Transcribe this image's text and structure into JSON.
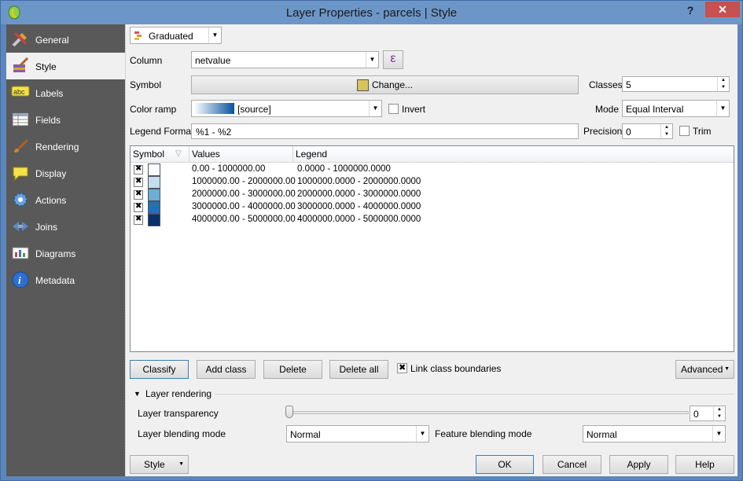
{
  "window": {
    "title": "Layer Properties - parcels | Style",
    "help_label": "?",
    "close_label": "✕"
  },
  "sidebar": {
    "items": [
      {
        "label": "General",
        "icon": "wrench-icon"
      },
      {
        "label": "Style",
        "icon": "paintbrush-icon"
      },
      {
        "label": "Labels",
        "icon": "abc-label-icon"
      },
      {
        "label": "Fields",
        "icon": "table-icon"
      },
      {
        "label": "Rendering",
        "icon": "brush-icon"
      },
      {
        "label": "Display",
        "icon": "speech-bubble-icon"
      },
      {
        "label": "Actions",
        "icon": "gear-icon"
      },
      {
        "label": "Joins",
        "icon": "join-icon"
      },
      {
        "label": "Diagrams",
        "icon": "diagram-icon"
      },
      {
        "label": "Metadata",
        "icon": "info-icon"
      }
    ],
    "active": "Style"
  },
  "renderer": {
    "type_label": "Graduated",
    "column_label": "Column",
    "column_value": "netvalue",
    "expression_label": "ε",
    "symbol_label": "Symbol",
    "change_label": "Change...",
    "classes_label": "Classes",
    "classes_value": "5",
    "color_ramp_label": "Color ramp",
    "color_ramp_value": "[source]",
    "invert_label": "Invert",
    "mode_label": "Mode",
    "mode_value": "Equal Interval",
    "legend_format_label": "Legend Format",
    "legend_format_value": "%1 - %2",
    "precision_label": "Precision",
    "precision_value": "0",
    "trim_label": "Trim"
  },
  "table": {
    "headers": {
      "symbol": "Symbol",
      "values": "Values",
      "legend": "Legend"
    },
    "rows": [
      {
        "color": "#f7fbff",
        "values": "0.00 - 1000000.00",
        "legend": "0.0000 - 1000000.0000"
      },
      {
        "color": "#c6dbef",
        "values": "1000000.00 - 2000000.00",
        "legend": "1000000.0000 - 2000000.0000"
      },
      {
        "color": "#6baed6",
        "values": "2000000.00 - 3000000.00",
        "legend": "2000000.0000 - 3000000.0000"
      },
      {
        "color": "#2171b5",
        "values": "3000000.00 - 4000000.00",
        "legend": "3000000.0000 - 4000000.0000"
      },
      {
        "color": "#08306b",
        "values": "4000000.00 - 5000000.00",
        "legend": "4000000.0000 - 5000000.0000"
      }
    ]
  },
  "actions": {
    "classify": "Classify",
    "add_class": "Add class",
    "delete": "Delete",
    "delete_all": "Delete all",
    "link_boundaries": "Link class boundaries",
    "advanced": "Advanced"
  },
  "layer_rendering": {
    "title": "Layer rendering",
    "transparency_label": "Layer transparency",
    "transparency_value": "0",
    "blending_label": "Layer blending mode",
    "blending_value": "Normal",
    "feature_blending_label": "Feature blending mode",
    "feature_blending_value": "Normal"
  },
  "footer": {
    "style": "Style",
    "ok": "OK",
    "cancel": "Cancel",
    "apply": "Apply",
    "help": "Help"
  },
  "colors": {
    "symbol_swatch": "#d8c45e",
    "ramp_start": "#f7fbff",
    "ramp_end": "#08519c"
  }
}
